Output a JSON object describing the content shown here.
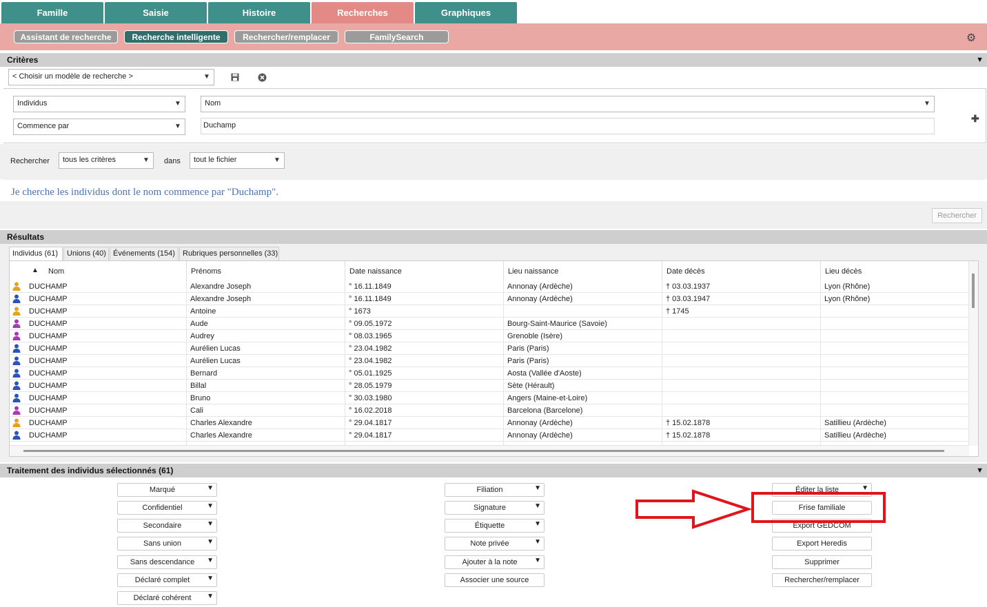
{
  "top_tabs": [
    "Famille",
    "Saisie",
    "Histoire",
    "Recherches",
    "Graphiques"
  ],
  "sub_tabs": [
    "Assistant de recherche",
    "Recherche intelligente",
    "Rechercher/remplacer",
    "FamilySearch"
  ],
  "criteria": {
    "header": "Critères",
    "template_select": "< Choisir un modèle de recherche >",
    "field1": "Individus",
    "field2": "Nom",
    "operator": "Commence par",
    "value": "Duchamp",
    "search_label": "Rechercher",
    "scope_select": "tous les critères",
    "dans_label": "dans",
    "file_select": "tout le fichier",
    "description": "Je cherche les individus dont le nom commence par \"Duchamp\".",
    "search_button": "Rechercher"
  },
  "results": {
    "header": "Résultats",
    "tabs": [
      "Individus (61)",
      "Unions (40)",
      "Événements (154)",
      "Rubriques personnelles (33)"
    ],
    "columns": [
      "Nom",
      "Prénoms",
      "Date naissance",
      "Lieu naissance",
      "Date décès",
      "Lieu décès"
    ],
    "rows": [
      {
        "sex": "unknown",
        "nom": "DUCHAMP",
        "prenoms": "Alexandre Joseph",
        "date_naissance": "° 16.11.1849",
        "lieu_naissance": "Annonay (Ardèche)",
        "date_deces": "† 03.03.1937",
        "lieu_deces": "Lyon (Rhône)"
      },
      {
        "sex": "male",
        "nom": "DUCHAMP",
        "prenoms": "Alexandre Joseph",
        "date_naissance": "° 16.11.1849",
        "lieu_naissance": "Annonay (Ardèche)",
        "date_deces": "† 03.03.1947",
        "lieu_deces": "Lyon (Rhône)"
      },
      {
        "sex": "unknown",
        "nom": "DUCHAMP",
        "prenoms": "Antoine",
        "date_naissance": "° 1673",
        "lieu_naissance": "",
        "date_deces": "† 1745",
        "lieu_deces": ""
      },
      {
        "sex": "female",
        "nom": "DUCHAMP",
        "prenoms": "Aude",
        "date_naissance": "° 09.05.1972",
        "lieu_naissance": "Bourg-Saint-Maurice (Savoie)",
        "date_deces": "",
        "lieu_deces": ""
      },
      {
        "sex": "female",
        "nom": "DUCHAMP",
        "prenoms": "Audrey",
        "date_naissance": "° 08.03.1965",
        "lieu_naissance": "Grenoble (Isère)",
        "date_deces": "",
        "lieu_deces": ""
      },
      {
        "sex": "male",
        "nom": "DUCHAMP",
        "prenoms": "Aurélien Lucas",
        "date_naissance": "° 23.04.1982",
        "lieu_naissance": "Paris (Paris)",
        "date_deces": "",
        "lieu_deces": ""
      },
      {
        "sex": "male",
        "nom": "DUCHAMP",
        "prenoms": "Aurélien Lucas",
        "date_naissance": "° 23.04.1982",
        "lieu_naissance": "Paris (Paris)",
        "date_deces": "",
        "lieu_deces": ""
      },
      {
        "sex": "male",
        "nom": "DUCHAMP",
        "prenoms": "Bernard",
        "date_naissance": "° 05.01.1925",
        "lieu_naissance": "Aosta (Vallée d'Aoste)",
        "date_deces": "",
        "lieu_deces": ""
      },
      {
        "sex": "male",
        "nom": "DUCHAMP",
        "prenoms": "Billal",
        "date_naissance": "° 28.05.1979",
        "lieu_naissance": "Sète (Hérault)",
        "date_deces": "",
        "lieu_deces": ""
      },
      {
        "sex": "male",
        "nom": "DUCHAMP",
        "prenoms": "Bruno",
        "date_naissance": "° 30.03.1980",
        "lieu_naissance": "Angers (Maine-et-Loire)",
        "date_deces": "",
        "lieu_deces": ""
      },
      {
        "sex": "female",
        "nom": "DUCHAMP",
        "prenoms": "Cali",
        "date_naissance": "° 16.02.2018",
        "lieu_naissance": "Barcelona (Barcelone)",
        "date_deces": "",
        "lieu_deces": ""
      },
      {
        "sex": "unknown",
        "nom": "DUCHAMP",
        "prenoms": "Charles Alexandre",
        "date_naissance": "° 29.04.1817",
        "lieu_naissance": "Annonay (Ardèche)",
        "date_deces": "† 15.02.1878",
        "lieu_deces": "Satillieu (Ardèche)"
      },
      {
        "sex": "male",
        "nom": "DUCHAMP",
        "prenoms": "Charles Alexandre",
        "date_naissance": "° 29.04.1817",
        "lieu_naissance": "Annonay (Ardèche)",
        "date_deces": "† 15.02.1878",
        "lieu_deces": "Satillieu (Ardèche)"
      }
    ]
  },
  "treatment": {
    "header": "Traitement des individus sélectionnés (61)",
    "col1": [
      "Marqué",
      "Confidentiel",
      "Secondaire",
      "Sans union",
      "Sans descendance",
      "Déclaré complet",
      "Déclaré cohérent"
    ],
    "col2": [
      "Filiation",
      "Signature",
      "Étiquette",
      "Note privée",
      "Ajouter à la note",
      "Associer une source"
    ],
    "col3": [
      "Éditer la liste",
      "Frise familiale",
      "Export GEDCOM",
      "Export Heredis",
      "Supprimer",
      "Rechercher/remplacer"
    ]
  },
  "colors": {
    "tab_teal": "#3f8f8a",
    "tab_active": "#e38a86",
    "subbar": "#eaa8a4",
    "annotation_red": "#e0141b",
    "description_blue": "#4a73b3"
  }
}
